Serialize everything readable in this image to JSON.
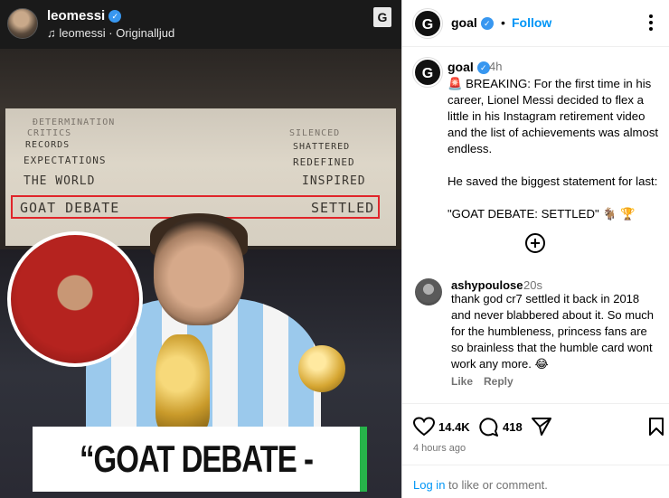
{
  "reel": {
    "username": "leomessi",
    "audio": "♫ leomessi · Originalljud",
    "badge": "G"
  },
  "list": [
    {
      "left": "RECORDS",
      "right": "SHATTERED"
    },
    {
      "left": "EXPECTATIONS",
      "right": "REDEFINED"
    },
    {
      "left": "THE WORLD",
      "right": "INSPIRED"
    },
    {
      "left": "GOAT DEBATE",
      "right": "SETTLED"
    }
  ],
  "banner": "“GOAT DEBATE - SETTLED”",
  "post": {
    "username": "goal",
    "dot": "•",
    "follow_label": "Follow",
    "logo": "G",
    "caption_time": "4h",
    "caption_lines": [
      "🚨 BREAKING: For the first time in his career, Lionel Messi decided to flex a little in his Instagram retirement video and the list of achievements was almost endless.",
      "He saved the biggest statement for last:",
      "\"GOAT DEBATE: SETTLED\" 🐐 🏆"
    ]
  },
  "comment": {
    "username": "ashypoulose",
    "time": "20s",
    "text": "thank god cr7 settled it back in 2018 and never blabbered about it. So much for the humbleness, princess fans are so brainless that the humble card wont work any more. 😂",
    "like_label": "Like",
    "reply_label": "Reply"
  },
  "actions": {
    "likes": "14.4K",
    "comments": "418"
  },
  "footer": {
    "time": "4 hours ago",
    "login_link": "Log in",
    "login_text": " to like or comment."
  },
  "colors": {
    "accent": "#0095f6",
    "verified": "#3897f0",
    "highlight": "#e0252a",
    "banner_border": "#27b34a"
  }
}
